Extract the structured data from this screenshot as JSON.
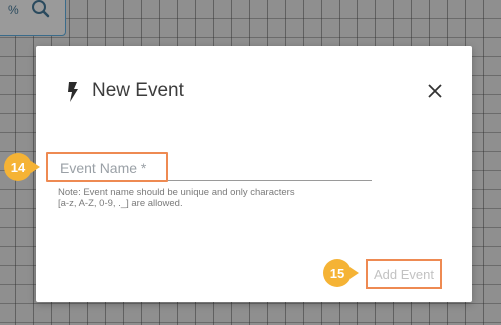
{
  "toolbar": {
    "zoom_suffix": "%",
    "zoom_icon": "zoom-icon"
  },
  "modal": {
    "title": "New Event",
    "title_icon": "bolt-icon",
    "close_icon": "close-icon",
    "close_label": "✕",
    "event_name": {
      "value": "",
      "placeholder": "Event Name *"
    },
    "note": "Note: Event name should be unique and only characters [a-z, A-Z, 0-9, ._] are allowed.",
    "add_button_label": "Add Event"
  },
  "annotations": [
    {
      "number": "14",
      "target": "event-name-field"
    },
    {
      "number": "15",
      "target": "add-event-button"
    }
  ],
  "colors": {
    "highlight": "#ee8a52",
    "badge": "#f5b335",
    "overlay": "#8f8f8f",
    "disabled_text": "#c2c2c2"
  }
}
